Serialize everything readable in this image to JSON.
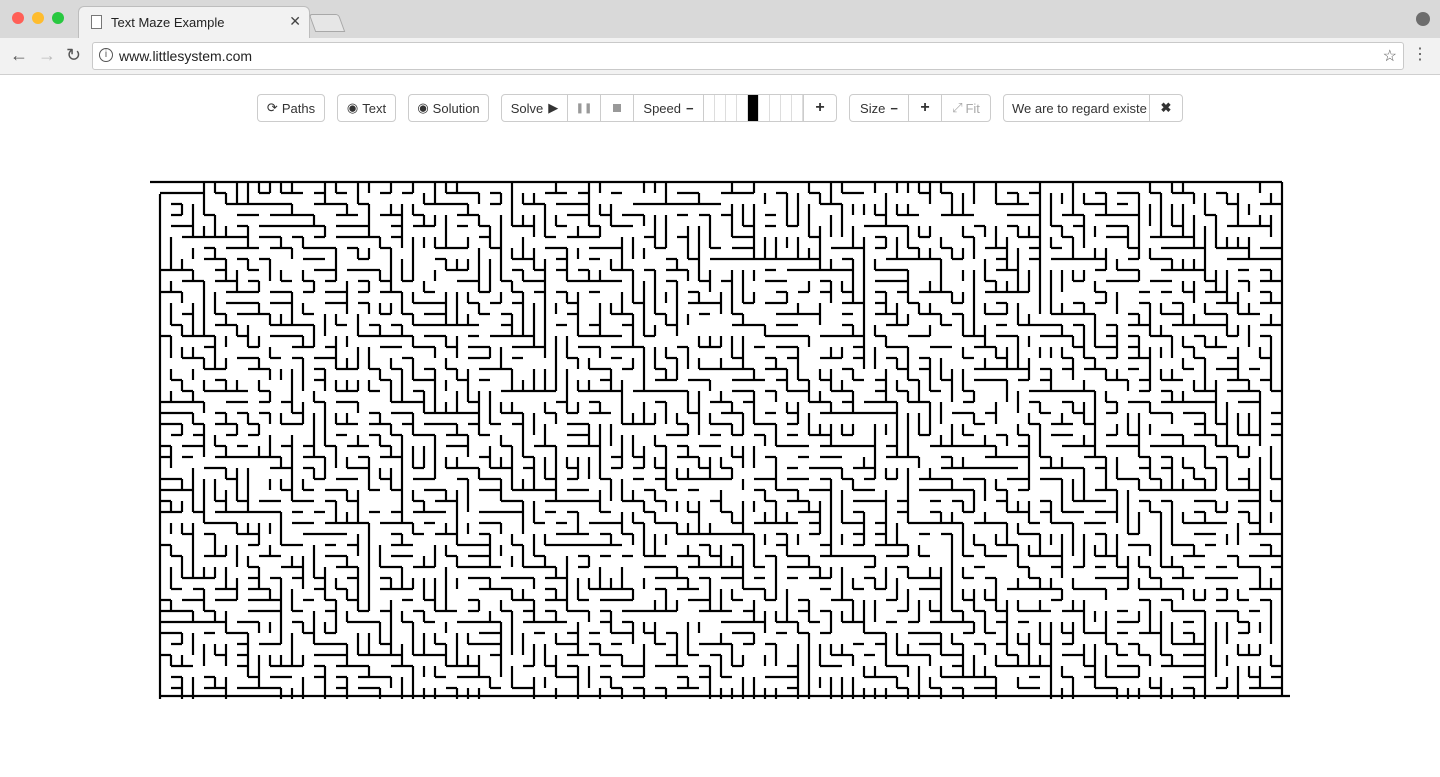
{
  "browser": {
    "tab_title": "Text Maze Example",
    "url": "www.littlesystem.com"
  },
  "toolbar": {
    "paths_label": "Paths",
    "text_label": "Text",
    "solution_label": "Solution",
    "solve_label": "Solve",
    "speed_label": "Speed",
    "speed_level": 5,
    "speed_levels": 9,
    "size_label": "Size",
    "fit_label": "Fit",
    "text_value": "We are to regard existe"
  },
  "colors": {
    "maze_stroke": "#000000",
    "chrome_bg": "#d9d9d9"
  }
}
